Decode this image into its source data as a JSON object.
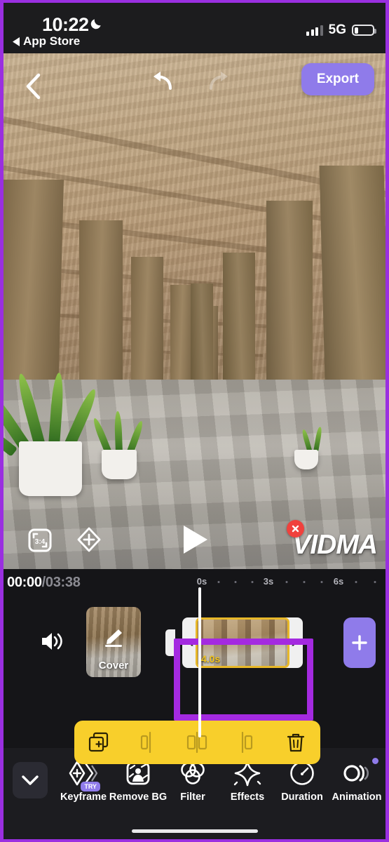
{
  "status_bar": {
    "time": "10:22",
    "moon_icon": "moon-icon",
    "back_label": "App Store",
    "back_icon": "triangle-left-icon",
    "signal_icon": "signal-bars-icon",
    "network": "5G",
    "battery_icon": "battery-low-icon"
  },
  "preview": {
    "back_icon": "chevron-left-icon",
    "undo_icon": "undo-arrow-icon",
    "redo_icon": "redo-arrow-icon",
    "export_label": "Export",
    "ratio_icon": "aspect-ratio-crop-icon",
    "ratio_value": "3:4",
    "keyframe_add_icon": "diamond-plus-icon",
    "play_icon": "play-triangle-icon",
    "watermark_text": "VIDMA",
    "watermark_close_icon": "close-x-icon"
  },
  "timeline": {
    "current_time": "00:00",
    "total_time": "/03:38",
    "ruler_ticks": [
      "0s",
      "3s",
      "6s"
    ],
    "volume_icon": "speaker-volume-icon",
    "cover": {
      "label": "Cover",
      "edit_icon": "pencil-edit-icon"
    },
    "clip": {
      "duration": "4.0s",
      "left_handle_icon": "chevron-left-trim-handle",
      "left_handle_glyph": "‹",
      "right_handle_icon": "chevron-right-trim-handle",
      "right_handle_glyph": "›"
    },
    "add_clip_icon": "plus-icon",
    "playhead_icon": "playhead-line"
  },
  "action_toolbar": {
    "accent_color": "#f8cf2b",
    "items": [
      {
        "name": "duplicate-clip-button",
        "icon": "duplicate-plus-icon",
        "enabled": true
      },
      {
        "name": "split-button",
        "icon": "split-icon",
        "enabled": false
      },
      {
        "name": "divide-button",
        "icon": "divide-frames-icon",
        "enabled": false
      },
      {
        "name": "trim-button",
        "icon": "trim-left-icon",
        "enabled": false
      },
      {
        "name": "delete-button",
        "icon": "trash-icon",
        "enabled": true
      }
    ]
  },
  "bottom_nav": {
    "collapse_icon": "chevron-down-icon",
    "items": [
      {
        "label": "Keyframe",
        "icon": "keyframe-diamond-icon",
        "badge": "TRY",
        "dot": false
      },
      {
        "label": "Remove BG",
        "icon": "remove-background-icon",
        "badge": null,
        "dot": false
      },
      {
        "label": "Filter",
        "icon": "filter-circles-icon",
        "badge": null,
        "dot": false
      },
      {
        "label": "Effects",
        "icon": "sparkle-star-icon",
        "badge": null,
        "dot": false
      },
      {
        "label": "Duration",
        "icon": "speedometer-icon",
        "badge": null,
        "dot": false
      },
      {
        "label": "Animation",
        "icon": "animation-motion-icon",
        "badge": null,
        "dot": true
      }
    ]
  },
  "annotation": {
    "highlight_color": "#a42ae0",
    "border_color": "#9a2fe0"
  },
  "colors": {
    "accent_purple": "#8f7bea",
    "clip_yellow": "#e8b829",
    "toolbar_yellow": "#f8cf2b",
    "background": "#151518",
    "close_red": "#f0413d"
  }
}
